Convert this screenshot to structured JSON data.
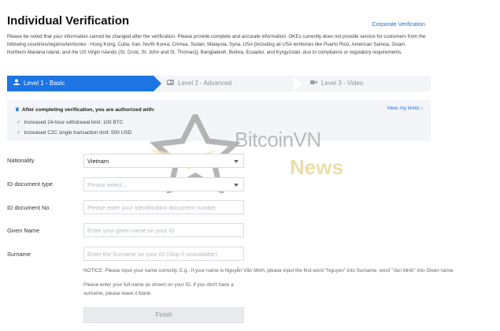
{
  "page": {
    "title": "Individual Verification",
    "corporate_link": "Corporate Verification",
    "notice": "Please be noted that your information cannot be changed after the verification. Please provide complete and accurate information. OKEx currently does not provide service for customers from the following countries/regions/territories - Hong Kong, Cuba, Iran, North Korea, Crimea, Sudan, Malaysia, Syria, USA [including all USA territories like Puerto Rico, American Samoa, Guam, Northern Mariana Island, and the US Virgin Islands (St. Croix, St. John and St. Thomas)], Bangladesh, Bolivia, Ecuador, and Kyrgyzstan, due to compliance or regulatory requirements."
  },
  "steps": [
    {
      "label": "Level 1 - Basic",
      "active": true,
      "icon": "user-icon"
    },
    {
      "label": "Level 2 - Advanced",
      "active": false,
      "icon": "id-card-icon"
    },
    {
      "label": "Level 3 - Video",
      "active": false,
      "icon": "video-icon"
    }
  ],
  "benefits": {
    "heading": "After completing verification, you are authorized with:",
    "view_limits": "View my limits",
    "items": [
      "Increased 24-hour withdrawal limit: 100 BTC",
      "Increased C2C single transaction limit: 500 USD"
    ]
  },
  "form": {
    "nationality": {
      "label": "Nationality",
      "value": "Vietnam"
    },
    "id_type": {
      "label": "ID document type",
      "placeholder": "Please select..."
    },
    "id_number": {
      "label": "ID document No.",
      "placeholder": "Please enter your Identification document number"
    },
    "given_name": {
      "label": "Given Name",
      "placeholder": "Enter your given name on your ID"
    },
    "surname": {
      "label": "Surname",
      "placeholder": "Enter the Surname on your ID (Skip if unavailable)"
    },
    "notice": "NOTICE: Please input your name correctly. E.g.: If your name is Nguyễn Văn Minh, please input the first word \"Nguyen\" into Surname, word \"Van Minh\" into Given name.",
    "hint": "Please enter your full name as shown on your ID. If you don't have a surname, please leave it blank.",
    "finish_label": "Finish"
  },
  "watermark": {
    "brand": "BitcoinVN",
    "sub": "News"
  },
  "colors": {
    "primary": "#1d74e3",
    "link": "#1d6fd6",
    "check": "#2ba24c"
  }
}
